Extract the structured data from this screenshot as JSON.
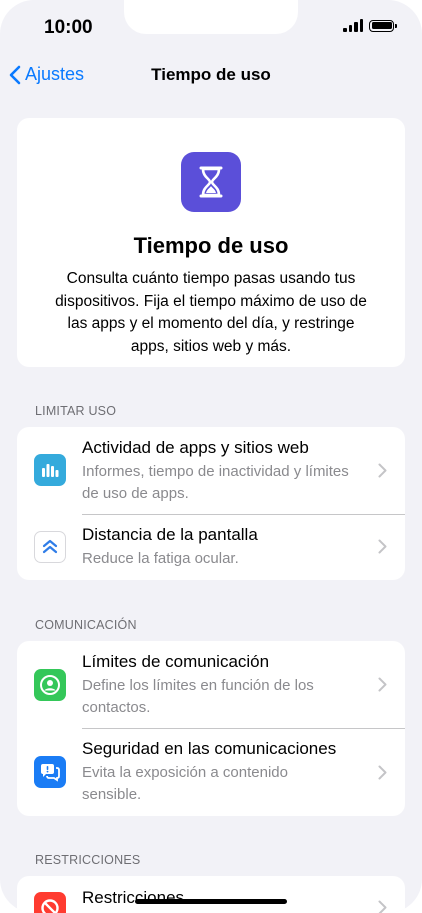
{
  "status": {
    "time": "10:00"
  },
  "nav": {
    "back_label": "Ajustes",
    "title": "Tiempo de uso"
  },
  "hero": {
    "title": "Tiempo de uso",
    "description": "Consulta cuánto tiempo pasas usando tus dispositivos. Fija el tiempo máximo de uso de las apps y el momento del día, y restringe apps, sitios web y más.",
    "icon": "hourglass-icon",
    "icon_color": "#5b4fd9"
  },
  "sections": [
    {
      "header": "LIMITAR USO",
      "rows": [
        {
          "title": "Actividad de apps y sitios web",
          "subtitle": "Informes, tiempo de inactividad y límites de uso de apps.",
          "icon": "bar-chart-icon",
          "icon_color": "#34aadc"
        },
        {
          "title": "Distancia de la pantalla",
          "subtitle": "Reduce la fatiga ocular.",
          "icon": "chevrons-up-icon",
          "icon_color": "#ffffff"
        }
      ]
    },
    {
      "header": "COMUNICACIÓN",
      "rows": [
        {
          "title": "Límites de comunicación",
          "subtitle": "Define los límites en función de los contactos.",
          "icon": "person-circle-icon",
          "icon_color": "#34c759"
        },
        {
          "title": "Seguridad en las comunicaciones",
          "subtitle": "Evita la exposición a contenido sensible.",
          "icon": "chat-bubbles-icon",
          "icon_color": "#1a7cf5"
        }
      ]
    },
    {
      "header": "RESTRICCIONES",
      "rows": [
        {
          "title": "Restricciones",
          "icon": "prohibited-icon",
          "icon_color": "#ff3b30"
        }
      ]
    }
  ]
}
